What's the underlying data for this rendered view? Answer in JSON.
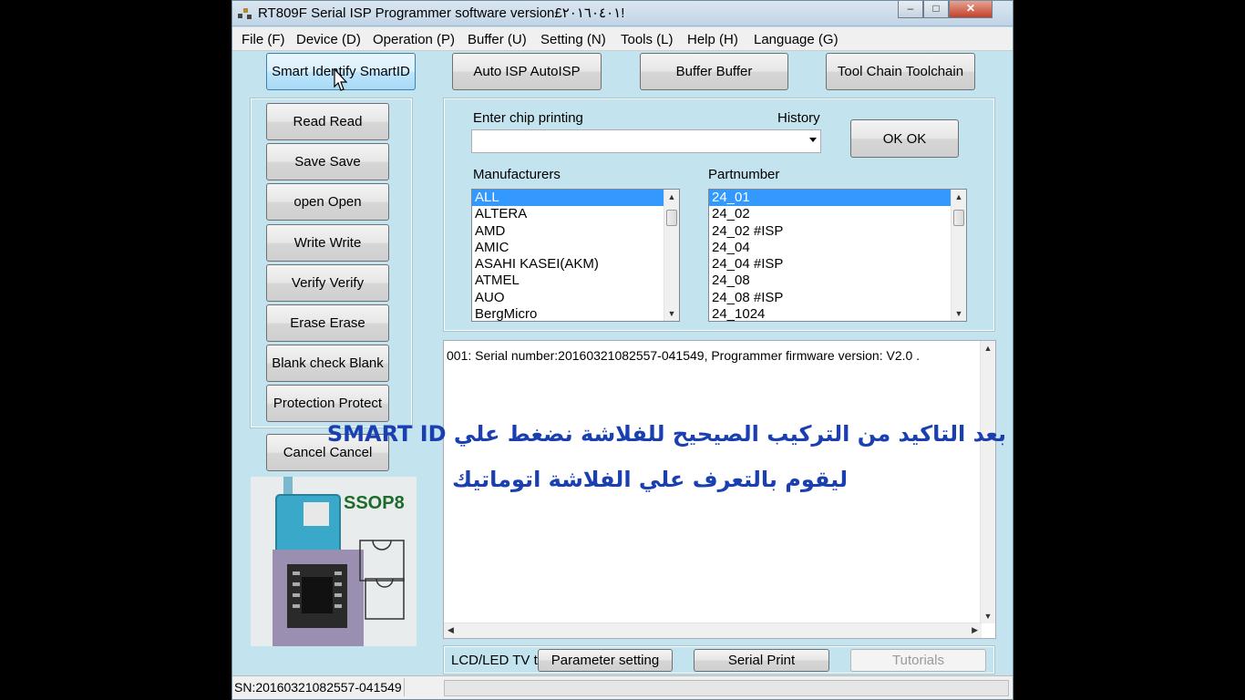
{
  "window": {
    "title": "RT809F Serial ISP Programmer software version£٢٠١٦٠٤٠١!"
  },
  "menu": [
    {
      "label": "File (F)"
    },
    {
      "label": "Device (D)"
    },
    {
      "label": "Operation (P)"
    },
    {
      "label": "Buffer (U)"
    },
    {
      "label": "Setting (N)"
    },
    {
      "label": "Tools (L)"
    },
    {
      "label": "Help (H)"
    },
    {
      "label": "Language (G)"
    }
  ],
  "toolbar": {
    "smart_id": "Smart Identify SmartID",
    "auto_isp": "Auto ISP AutoISP",
    "buffer": "Buffer Buffer",
    "toolchain": "Tool Chain Toolchain"
  },
  "actions": [
    {
      "label": "Read Read"
    },
    {
      "label": "Save Save"
    },
    {
      "label": "open Open"
    },
    {
      "label": "Write Write"
    },
    {
      "label": "Verify Verify"
    },
    {
      "label": "Erase Erase"
    },
    {
      "label": "Blank check Blank"
    },
    {
      "label": "Protection Protect"
    }
  ],
  "cancel_label": "Cancel Cancel",
  "chip": {
    "enter_label": "Enter chip printing",
    "history_label": "History",
    "value": "",
    "ok_label": "OK OK"
  },
  "manufacturers": {
    "label": "Manufacturers",
    "items": [
      "ALL",
      "ALTERA",
      "AMD",
      "AMIC",
      "ASAHI KASEI(AKM)",
      "ATMEL",
      "AUO",
      "BergMicro"
    ]
  },
  "partnumbers": {
    "label": "Partnumber",
    "items": [
      "24_01",
      "24_02",
      "24_02 #ISP",
      "24_04",
      "24_04 #ISP",
      "24_08",
      "24_08 #ISP",
      "24_1024"
    ]
  },
  "log": {
    "line1": "001:  Serial number:20160321082557-041549, Programmer firmware version: V2.0 ."
  },
  "overlay": {
    "line1": "بعد التاكيد من التركيب الصيحيح للفلاشة نضغط علي SMART ID",
    "line2": "ليقوم بالتعرف علي الفلاشة اتوماتيك"
  },
  "chip_image_label": "SSOP8",
  "bottom": {
    "lcd_label": "LCD/LED TV tool",
    "parameter": "Parameter setting",
    "serial_print": "Serial Print",
    "tutorials": "Tutorials"
  },
  "status": {
    "sn": "SN:20160321082557-041549"
  }
}
